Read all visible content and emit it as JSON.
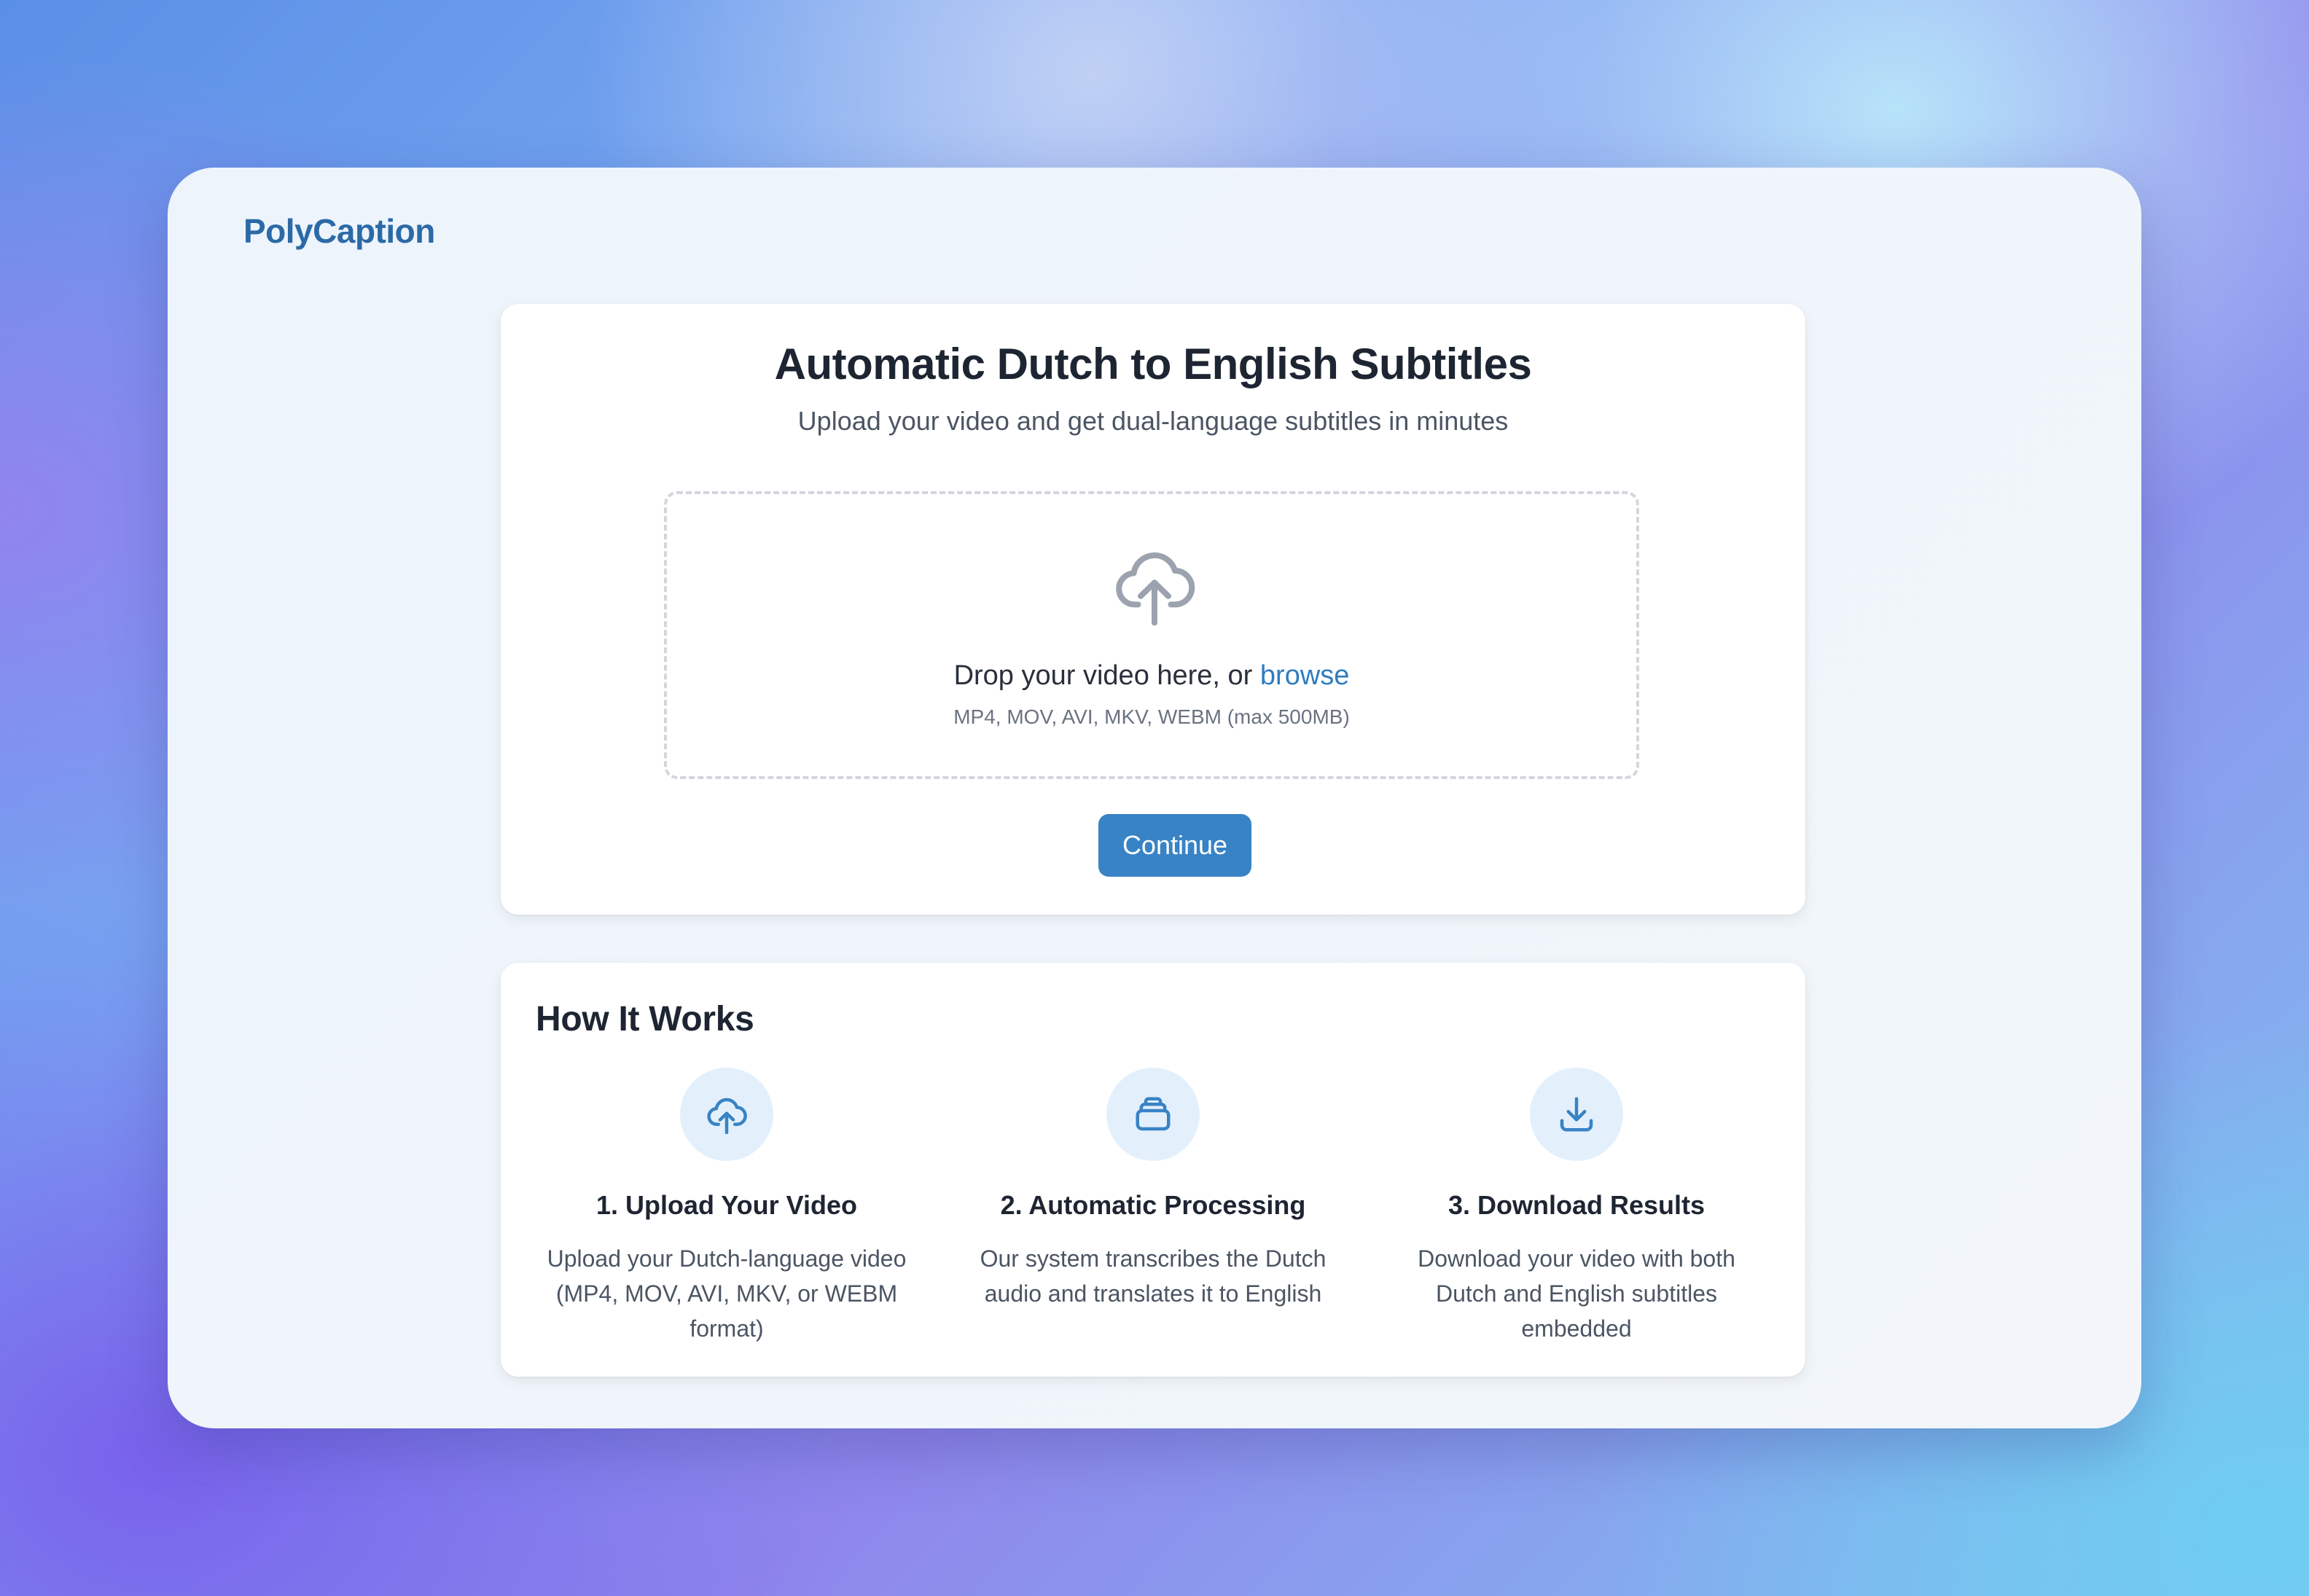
{
  "brand": {
    "name": "PolyCaption"
  },
  "hero": {
    "title": "Automatic Dutch to English Subtitles",
    "subtitle": "Upload your video and get dual-language subtitles in minutes"
  },
  "dropzone": {
    "icon": "cloud-upload-icon",
    "prompt": "Drop your video here, or ",
    "browse_label": "browse",
    "formats": "MP4, MOV, AVI, MKV, WEBM (max 500MB)"
  },
  "actions": {
    "continue_label": "Continue"
  },
  "how_it_works": {
    "title": "How It Works",
    "steps": [
      {
        "icon": "cloud-upload-icon",
        "title": "1. Upload Your Video",
        "description": "Upload your Dutch-language video (MP4, MOV, AVI, MKV, or WEBM format)"
      },
      {
        "icon": "processing-stack-icon",
        "title": "2. Automatic Processing",
        "description": "Our system transcribes the Dutch audio and translates it to English"
      },
      {
        "icon": "download-icon",
        "title": "3. Download Results",
        "description": "Download your video with both Dutch and English subtitles embedded"
      }
    ]
  },
  "colors": {
    "accent": "#3883c5",
    "brand": "#2b6aa6",
    "link": "#2f7cc0",
    "icon_circle": "#e3f0fc"
  }
}
